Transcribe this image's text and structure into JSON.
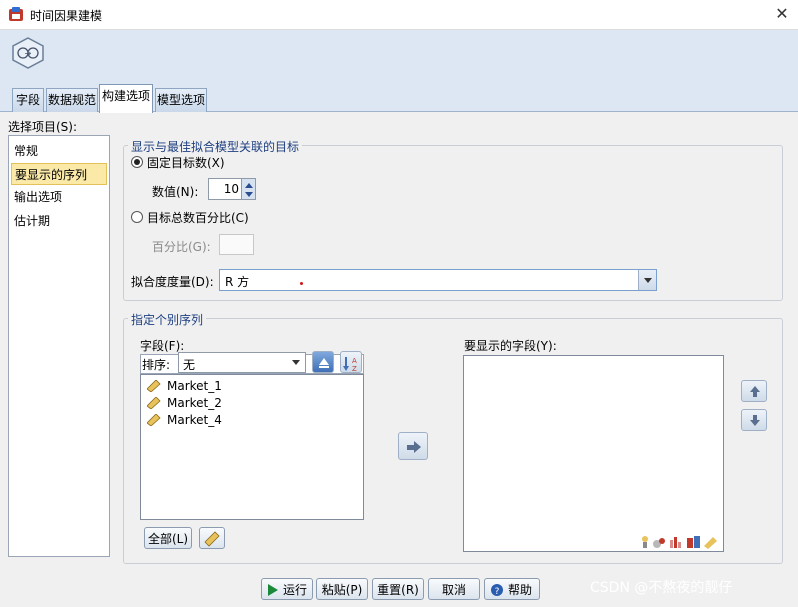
{
  "window": {
    "title": "时间因果建模",
    "close_symbol": "✕"
  },
  "tabs": [
    {
      "label": "字段",
      "active": false
    },
    {
      "label": "数据规范",
      "active": false
    },
    {
      "label": "构建选项",
      "active": true
    },
    {
      "label": "模型选项",
      "active": false
    }
  ],
  "left_panel": {
    "label": "选择项目(S):",
    "items": [
      "常规",
      "要显示的序列",
      "输出选项",
      "估计期"
    ],
    "selected_index": 1
  },
  "targets_group": {
    "legend": "显示与最佳拟合模型关联的目标",
    "fixed_radio_label": "固定目标数(X)",
    "value_label": "数值(N):",
    "value": "10",
    "percent_radio_label": "目标总数百分比(C)",
    "percent_label": "百分比(G):",
    "percent_value": "",
    "fit_label": "拟合度度量(D):",
    "fit_value": "R 方"
  },
  "series_group": {
    "legend": "指定个别序列",
    "fields_label": "字段(F):",
    "sort_label": "排序:",
    "sort_value": "无",
    "fields": [
      "Market_1",
      "Market_2",
      "Market_4"
    ],
    "display_label": "要显示的字段(Y):",
    "all_button": "全部(L)"
  },
  "buttons": {
    "run": "运行",
    "paste": "粘贴(P)",
    "reset": "重置(R)",
    "cancel": "取消",
    "help": "帮助"
  },
  "watermark": "CSDN @不熬夜的靓仔",
  "colors": {
    "accent": "#1e3f80",
    "selection": "#fbe9a8",
    "toolbar": "#dde7f3"
  }
}
